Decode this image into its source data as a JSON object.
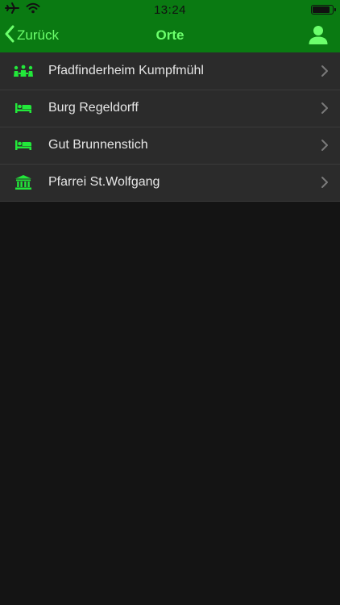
{
  "status_bar": {
    "time": "13:24",
    "icons": [
      "airplane-icon",
      "wifi-icon",
      "battery-icon"
    ]
  },
  "navbar": {
    "back_label": "Zurück",
    "title": "Orte",
    "right_icon": "user-icon"
  },
  "places": [
    {
      "label": "Pfadfinderheim Kumpfmühl",
      "icon": "group-icon"
    },
    {
      "label": "Burg Regeldorff",
      "icon": "bed-icon"
    },
    {
      "label": "Gut Brunnenstich",
      "icon": "bed-icon"
    },
    {
      "label": "Pfarrei St.Wolfgang",
      "icon": "building-icon"
    }
  ],
  "colors": {
    "nav_background": "#0a7a12",
    "accent": "#6cff6c",
    "icon_green": "#22e83a",
    "list_background": "#2b2b2b",
    "page_background": "#141414"
  }
}
